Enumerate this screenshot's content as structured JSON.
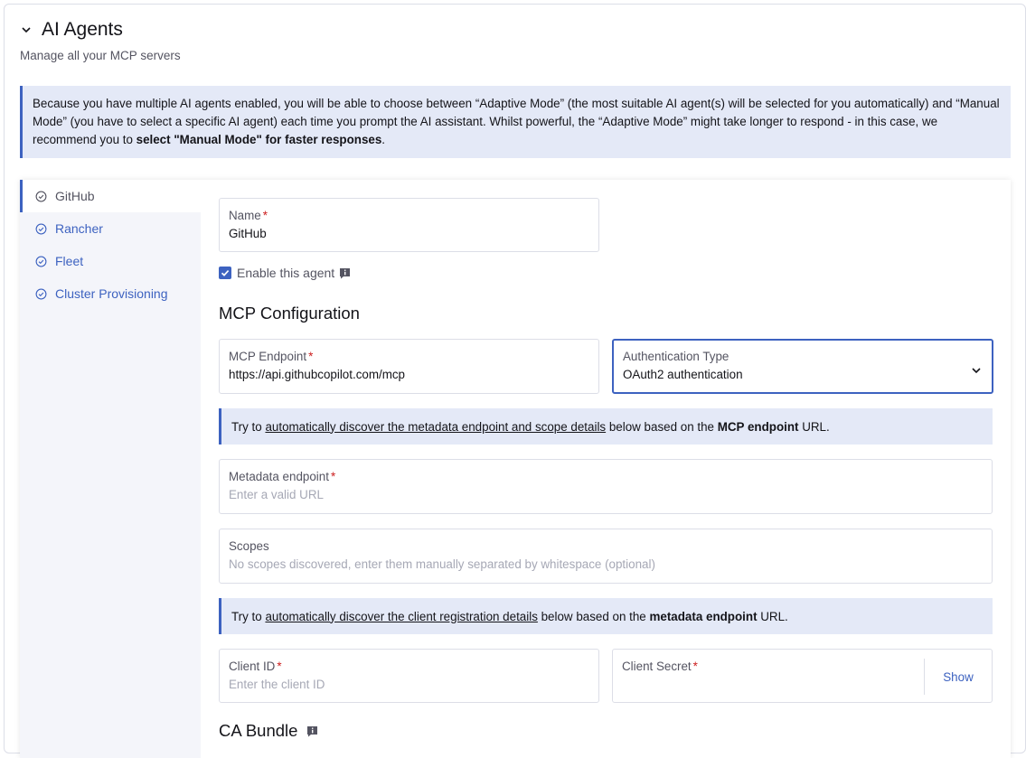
{
  "header": {
    "title": "AI Agents",
    "subtitle": "Manage all your MCP servers"
  },
  "banner": {
    "text_before": "Because you have multiple AI agents enabled, you will be able to choose between “Adaptive Mode” (the most suitable AI agent(s) will be selected for you automatically) and “Manual Mode” (you have to select a specific AI agent) each time you prompt the AI assistant. Whilst powerful, the “Adaptive Mode” might take longer to respond - in this case, we recommend you to ",
    "text_bold": "select \"Manual Mode\" for faster responses",
    "text_after": "."
  },
  "sidebar": {
    "items": [
      {
        "label": "GitHub",
        "active": true
      },
      {
        "label": "Rancher",
        "active": false
      },
      {
        "label": "Fleet",
        "active": false
      },
      {
        "label": "Cluster Provisioning",
        "active": false
      }
    ]
  },
  "form": {
    "name": {
      "label": "Name",
      "value": "GitHub"
    },
    "enable": {
      "label": "Enable this agent",
      "checked": true
    },
    "mcp_section": "MCP Configuration",
    "mcp_endpoint": {
      "label": "MCP Endpoint",
      "value": "https://api.githubcopilot.com/mcp"
    },
    "auth_type": {
      "label": "Authentication Type",
      "value": "OAuth2 authentication"
    },
    "discover_metadata": {
      "prefix": "Try to ",
      "link": "automatically discover the metadata endpoint and scope details",
      "middle": " below based on the ",
      "bold": "MCP endpoint",
      "suffix": " URL."
    },
    "metadata_endpoint": {
      "label": "Metadata endpoint",
      "placeholder": "Enter a valid URL"
    },
    "scopes": {
      "label": "Scopes",
      "placeholder": "No scopes discovered, enter them manually separated by whitespace (optional)"
    },
    "discover_client": {
      "prefix": "Try to ",
      "link": "automatically discover the client registration details",
      "middle": " below based on the ",
      "bold": "metadata endpoint",
      "suffix": " URL."
    },
    "client_id": {
      "label": "Client ID",
      "placeholder": "Enter the client ID"
    },
    "client_secret": {
      "label": "Client Secret",
      "show_label": "Show"
    },
    "ca_section": "CA Bundle",
    "required_mark": "*"
  },
  "colors": {
    "accent": "#3d62c0",
    "banner_bg": "#e4e9f7",
    "required": "#cc1f1f",
    "sidebar_bg": "#f4f5fa"
  }
}
